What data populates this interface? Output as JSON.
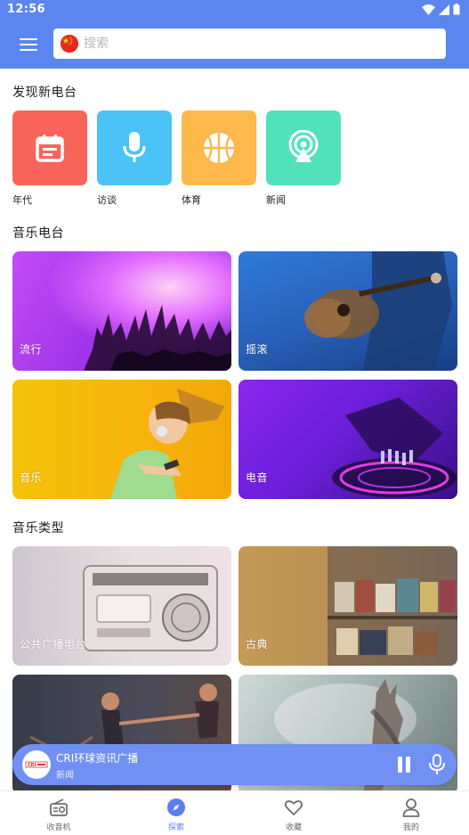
{
  "status_bar": {
    "time": "12:56"
  },
  "search": {
    "placeholder": "搜索"
  },
  "discover": {
    "title": "发现新电台",
    "items": [
      {
        "label": "年代",
        "icon": "calendar-icon",
        "color": "#f9645a"
      },
      {
        "label": "访谈",
        "icon": "microphone-icon",
        "color": "#4bc3f7"
      },
      {
        "label": "体育",
        "icon": "basketball-icon",
        "color": "#fdb94c"
      },
      {
        "label": "新闻",
        "icon": "podcast-icon",
        "color": "#51e2bc"
      }
    ]
  },
  "music_radio": {
    "title": "音乐电台",
    "cards": [
      {
        "label": "流行"
      },
      {
        "label": "摇滚"
      },
      {
        "label": "音乐"
      },
      {
        "label": "电音"
      }
    ]
  },
  "music_types": {
    "title": "音乐类型",
    "cards": [
      {
        "label": "公共广播电台"
      },
      {
        "label": "古典"
      },
      {
        "label": ""
      },
      {
        "label": ""
      }
    ]
  },
  "player": {
    "title": "CRI环球资讯广播",
    "subtitle": "新闻",
    "logo_text": "CRI"
  },
  "bottom_nav": {
    "items": [
      {
        "label": "收音机",
        "icon": "radio-icon",
        "active": false
      },
      {
        "label": "探索",
        "icon": "compass-icon",
        "active": true
      },
      {
        "label": "收藏",
        "icon": "heart-icon",
        "active": false
      },
      {
        "label": "我的",
        "icon": "user-icon",
        "active": false
      }
    ]
  },
  "colors": {
    "primary": "#5b86f0",
    "player": "#7090f3",
    "nav_active": "#5b7ef0"
  }
}
